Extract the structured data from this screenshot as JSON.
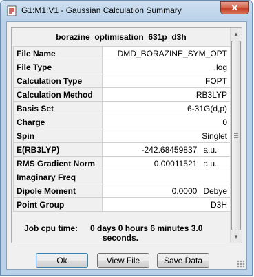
{
  "window": {
    "title": "G1:M1:V1 - Gaussian Calculation Summary",
    "close_glyph": "✕"
  },
  "panel": {
    "heading": "borazine_optimisation_631p_d3h"
  },
  "rows": [
    {
      "label": "File Name",
      "value": "DMD_BORAZINE_SYM_OPT",
      "unit": ""
    },
    {
      "label": "File Type",
      "value": ".log",
      "unit": ""
    },
    {
      "label": "Calculation Type",
      "value": "FOPT",
      "unit": ""
    },
    {
      "label": "Calculation Method",
      "value": "RB3LYP",
      "unit": ""
    },
    {
      "label": "Basis Set",
      "value": "6-31G(d,p)",
      "unit": ""
    },
    {
      "label": "Charge",
      "value": "0",
      "unit": ""
    },
    {
      "label": "Spin",
      "value": "Singlet",
      "unit": ""
    },
    {
      "label": "E(RB3LYP)",
      "value": "-242.68459837",
      "unit": "a.u."
    },
    {
      "label": "RMS Gradient Norm",
      "value": "0.00011521",
      "unit": "a.u."
    },
    {
      "label": "Imaginary Freq",
      "value": "",
      "unit": ""
    },
    {
      "label": "Dipole Moment",
      "value": "0.0000",
      "unit": "Debye"
    },
    {
      "label": "Point Group",
      "value": "D3H",
      "unit": ""
    }
  ],
  "cpu": {
    "label": "Job cpu time:",
    "value": "0 days  0 hours  6 minutes  3.0",
    "value_cont": "seconds."
  },
  "buttons": {
    "ok": "Ok",
    "view_file": "View File",
    "save_data": "Save Data"
  }
}
